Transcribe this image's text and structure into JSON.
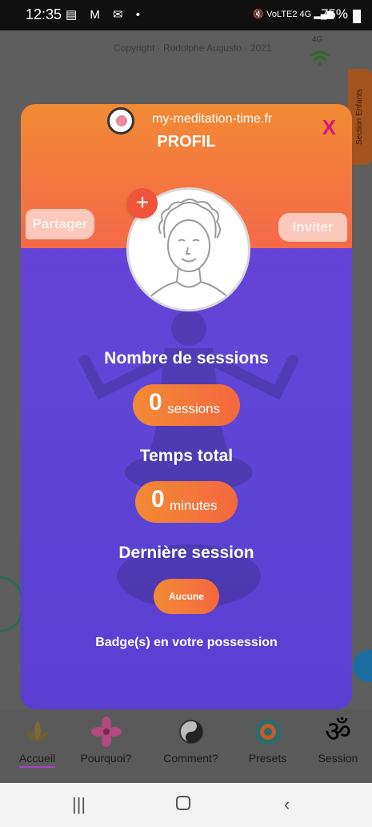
{
  "status_bar": {
    "time": "12:35",
    "left_icons": "▤ M ✉ •",
    "right_icons": "🔇 VoLTE2 4G ▂▄▆",
    "battery": "75%"
  },
  "background": {
    "copyright": "Copyright · Rodolphe Augusto · 2021",
    "signal": "4G",
    "side_tab": "Section Enfants"
  },
  "modal": {
    "site_name": "my-meditation-time.fr",
    "title": "PROFIL",
    "close_label": "X",
    "share_label": "Partager",
    "invite_label": "Inviter",
    "add_photo_label": "+",
    "sessions_title": "Nombre de sessions",
    "sessions_value": "0",
    "sessions_unit": "sessions",
    "total_title": "Temps total",
    "total_value": "0",
    "total_unit": "minutes",
    "last_title": "Dernière session",
    "last_value": "Aucune",
    "badges_title": "Badge(s) en votre possession"
  },
  "bottom_nav": {
    "items": [
      {
        "label": "Accueil",
        "icon": "lotus-icon",
        "active": true
      },
      {
        "label": "Pourquoi?",
        "icon": "flower-icon",
        "active": false
      },
      {
        "label": "Comment?",
        "icon": "yin-yang-icon",
        "active": false
      },
      {
        "label": "Presets",
        "icon": "mandala-icon",
        "active": false
      },
      {
        "label": "Session",
        "icon": "om-icon",
        "active": false
      }
    ]
  },
  "colors": {
    "header_orange": "#f47642",
    "modal_purple": "#5f46d6",
    "close_magenta": "#d2187a",
    "active_underline": "#a146c1"
  }
}
